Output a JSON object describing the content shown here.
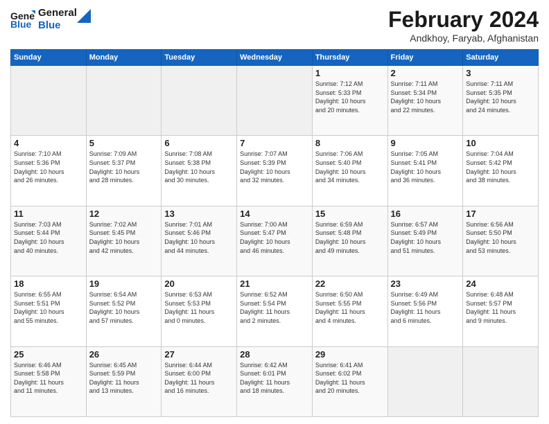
{
  "logo": {
    "line1": "General",
    "line2": "Blue"
  },
  "title": "February 2024",
  "subtitle": "Andkhoy, Faryab, Afghanistan",
  "days_header": [
    "Sunday",
    "Monday",
    "Tuesday",
    "Wednesday",
    "Thursday",
    "Friday",
    "Saturday"
  ],
  "weeks": [
    [
      {
        "day": "",
        "info": ""
      },
      {
        "day": "",
        "info": ""
      },
      {
        "day": "",
        "info": ""
      },
      {
        "day": "",
        "info": ""
      },
      {
        "day": "1",
        "info": "Sunrise: 7:12 AM\nSunset: 5:33 PM\nDaylight: 10 hours\nand 20 minutes."
      },
      {
        "day": "2",
        "info": "Sunrise: 7:11 AM\nSunset: 5:34 PM\nDaylight: 10 hours\nand 22 minutes."
      },
      {
        "day": "3",
        "info": "Sunrise: 7:11 AM\nSunset: 5:35 PM\nDaylight: 10 hours\nand 24 minutes."
      }
    ],
    [
      {
        "day": "4",
        "info": "Sunrise: 7:10 AM\nSunset: 5:36 PM\nDaylight: 10 hours\nand 26 minutes."
      },
      {
        "day": "5",
        "info": "Sunrise: 7:09 AM\nSunset: 5:37 PM\nDaylight: 10 hours\nand 28 minutes."
      },
      {
        "day": "6",
        "info": "Sunrise: 7:08 AM\nSunset: 5:38 PM\nDaylight: 10 hours\nand 30 minutes."
      },
      {
        "day": "7",
        "info": "Sunrise: 7:07 AM\nSunset: 5:39 PM\nDaylight: 10 hours\nand 32 minutes."
      },
      {
        "day": "8",
        "info": "Sunrise: 7:06 AM\nSunset: 5:40 PM\nDaylight: 10 hours\nand 34 minutes."
      },
      {
        "day": "9",
        "info": "Sunrise: 7:05 AM\nSunset: 5:41 PM\nDaylight: 10 hours\nand 36 minutes."
      },
      {
        "day": "10",
        "info": "Sunrise: 7:04 AM\nSunset: 5:42 PM\nDaylight: 10 hours\nand 38 minutes."
      }
    ],
    [
      {
        "day": "11",
        "info": "Sunrise: 7:03 AM\nSunset: 5:44 PM\nDaylight: 10 hours\nand 40 minutes."
      },
      {
        "day": "12",
        "info": "Sunrise: 7:02 AM\nSunset: 5:45 PM\nDaylight: 10 hours\nand 42 minutes."
      },
      {
        "day": "13",
        "info": "Sunrise: 7:01 AM\nSunset: 5:46 PM\nDaylight: 10 hours\nand 44 minutes."
      },
      {
        "day": "14",
        "info": "Sunrise: 7:00 AM\nSunset: 5:47 PM\nDaylight: 10 hours\nand 46 minutes."
      },
      {
        "day": "15",
        "info": "Sunrise: 6:59 AM\nSunset: 5:48 PM\nDaylight: 10 hours\nand 49 minutes."
      },
      {
        "day": "16",
        "info": "Sunrise: 6:57 AM\nSunset: 5:49 PM\nDaylight: 10 hours\nand 51 minutes."
      },
      {
        "day": "17",
        "info": "Sunrise: 6:56 AM\nSunset: 5:50 PM\nDaylight: 10 hours\nand 53 minutes."
      }
    ],
    [
      {
        "day": "18",
        "info": "Sunrise: 6:55 AM\nSunset: 5:51 PM\nDaylight: 10 hours\nand 55 minutes."
      },
      {
        "day": "19",
        "info": "Sunrise: 6:54 AM\nSunset: 5:52 PM\nDaylight: 10 hours\nand 57 minutes."
      },
      {
        "day": "20",
        "info": "Sunrise: 6:53 AM\nSunset: 5:53 PM\nDaylight: 11 hours\nand 0 minutes."
      },
      {
        "day": "21",
        "info": "Sunrise: 6:52 AM\nSunset: 5:54 PM\nDaylight: 11 hours\nand 2 minutes."
      },
      {
        "day": "22",
        "info": "Sunrise: 6:50 AM\nSunset: 5:55 PM\nDaylight: 11 hours\nand 4 minutes."
      },
      {
        "day": "23",
        "info": "Sunrise: 6:49 AM\nSunset: 5:56 PM\nDaylight: 11 hours\nand 6 minutes."
      },
      {
        "day": "24",
        "info": "Sunrise: 6:48 AM\nSunset: 5:57 PM\nDaylight: 11 hours\nand 9 minutes."
      }
    ],
    [
      {
        "day": "25",
        "info": "Sunrise: 6:46 AM\nSunset: 5:58 PM\nDaylight: 11 hours\nand 11 minutes."
      },
      {
        "day": "26",
        "info": "Sunrise: 6:45 AM\nSunset: 5:59 PM\nDaylight: 11 hours\nand 13 minutes."
      },
      {
        "day": "27",
        "info": "Sunrise: 6:44 AM\nSunset: 6:00 PM\nDaylight: 11 hours\nand 16 minutes."
      },
      {
        "day": "28",
        "info": "Sunrise: 6:42 AM\nSunset: 6:01 PM\nDaylight: 11 hours\nand 18 minutes."
      },
      {
        "day": "29",
        "info": "Sunrise: 6:41 AM\nSunset: 6:02 PM\nDaylight: 11 hours\nand 20 minutes."
      },
      {
        "day": "",
        "info": ""
      },
      {
        "day": "",
        "info": ""
      }
    ]
  ]
}
